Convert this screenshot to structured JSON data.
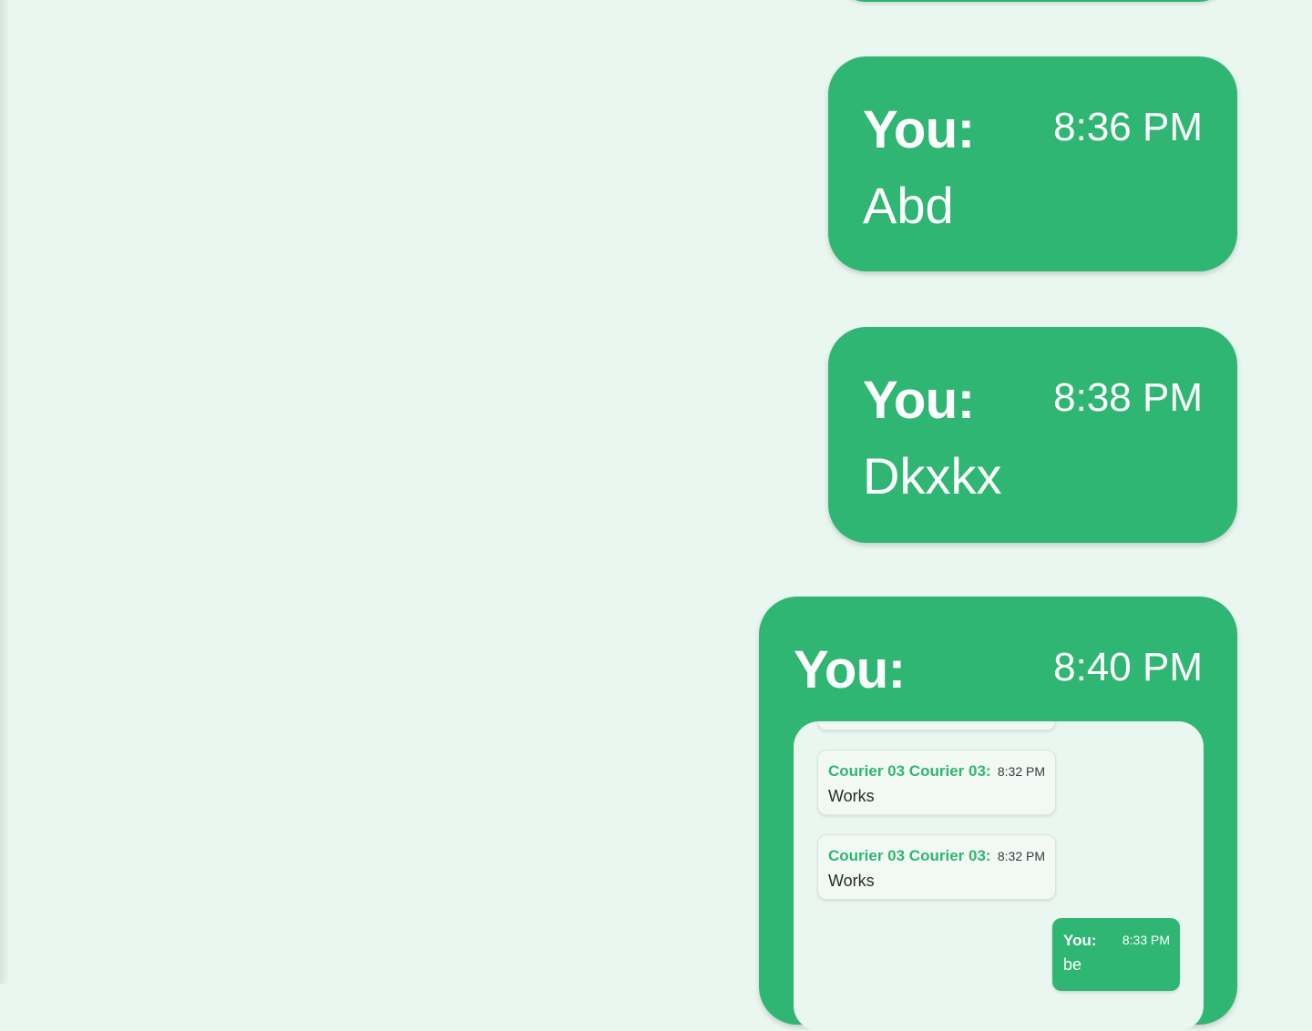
{
  "colors": {
    "background": "#eaf6f0",
    "outgoing_bubble": "#2fb673",
    "incoming_bubble": "#f2f9f5",
    "incoming_sender_text": "#2fb673"
  },
  "messages": [
    {
      "sender": "You:",
      "time": "8:36 PM",
      "text": "Abd"
    },
    {
      "sender": "You:",
      "time": "8:38 PM",
      "text": "Dkxkx"
    },
    {
      "sender": "You:",
      "time": "8:40 PM",
      "attachment": {
        "type": "screenshot",
        "messages": [
          {
            "sender": "Courier 03 Courier 03:",
            "time": "8:32 PM",
            "text": "Works"
          },
          {
            "sender": "Courier 03 Courier 03:",
            "time": "8:32 PM",
            "text": "Works"
          },
          {
            "sender": "You:",
            "time": "8:33 PM",
            "text": "be"
          }
        ]
      }
    }
  ]
}
